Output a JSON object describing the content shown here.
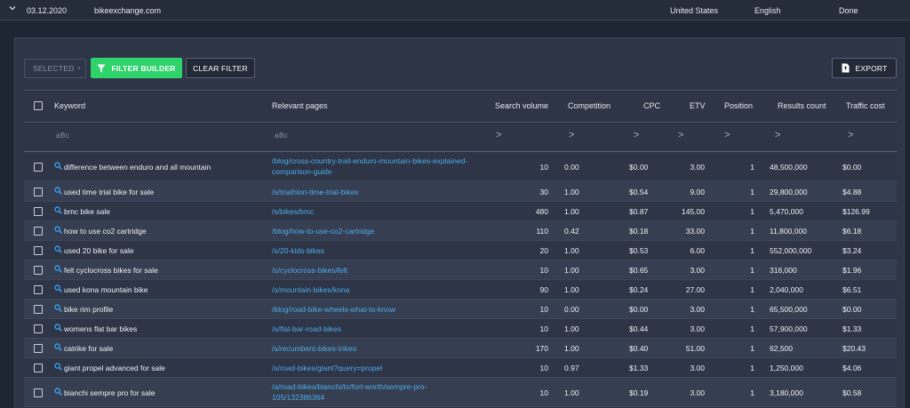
{
  "summary": {
    "date": "03.12.2020",
    "domain": "bikeexchange.com",
    "country": "United States",
    "language": "English",
    "status": "Done"
  },
  "toolbar": {
    "selected_label": "SELECTED",
    "filter_builder_label": "FILTER BUILDER",
    "clear_filter_label": "CLEAR FILTER",
    "export_label": "EXPORT"
  },
  "columns": {
    "keyword": "Keyword",
    "relevant_pages": "Relevant pages",
    "search_volume": "Search volume",
    "competition": "Competition",
    "cpc": "CPC",
    "etv": "ETV",
    "position": "Position",
    "results_count": "Results count",
    "traffic_cost": "Traffic cost"
  },
  "filters": {
    "text_symbol": "aBc",
    "number_symbol": ">"
  },
  "icons": {
    "magnifier": "search-icon",
    "funnel": "filter-icon",
    "export": "export-file-icon",
    "chevron": "chevron-down-icon"
  },
  "colors": {
    "accent_green": "#2fd36c",
    "link_blue": "#4fa9e8",
    "magnifier_blue": "#3b9be8"
  },
  "rows": [
    {
      "keyword": "difference between enduro and all mountain",
      "page": "/blog/cross-country-trail-enduro-mountain-bikes-explained-comparison-guide",
      "volume": "10",
      "competition": "0.00",
      "cpc": "$0.00",
      "etv": "3.00",
      "position": "1",
      "results": "48,500,000",
      "cost": "$0.00"
    },
    {
      "keyword": "used time trial bike for sale",
      "page": "/s/triathlon-time-trial-bikes",
      "volume": "30",
      "competition": "1.00",
      "cpc": "$0.54",
      "etv": "9.00",
      "position": "1",
      "results": "29,800,000",
      "cost": "$4.88"
    },
    {
      "keyword": "bmc bike sale",
      "page": "/s/bikes/bmc",
      "volume": "480",
      "competition": "1.00",
      "cpc": "$0.87",
      "etv": "145.00",
      "position": "1",
      "results": "5,470,000",
      "cost": "$126.99"
    },
    {
      "keyword": "how to use co2 cartridge",
      "page": "/blog/how-to-use-co2-cartridge",
      "volume": "110",
      "competition": "0.42",
      "cpc": "$0.18",
      "etv": "33.00",
      "position": "1",
      "results": "11,800,000",
      "cost": "$6.18"
    },
    {
      "keyword": "used 20 bike for sale",
      "page": "/s/20-kids-bikes",
      "volume": "20",
      "competition": "1.00",
      "cpc": "$0.53",
      "etv": "6.00",
      "position": "1",
      "results": "552,000,000",
      "cost": "$3.24"
    },
    {
      "keyword": "felt cyclocross bikes for sale",
      "page": "/s/cyclocross-bikes/felt",
      "volume": "10",
      "competition": "1.00",
      "cpc": "$0.65",
      "etv": "3.00",
      "position": "1",
      "results": "316,000",
      "cost": "$1.96"
    },
    {
      "keyword": "used kona mountain bike",
      "page": "/s/mountain-bikes/kona",
      "volume": "90",
      "competition": "1.00",
      "cpc": "$0.24",
      "etv": "27.00",
      "position": "1",
      "results": "2,040,000",
      "cost": "$6.51"
    },
    {
      "keyword": "bike rim profile",
      "page": "/blog/road-bike-wheels-what-to-know",
      "volume": "10",
      "competition": "0.00",
      "cpc": "$0.00",
      "etv": "3.00",
      "position": "1",
      "results": "65,500,000",
      "cost": "$0.00"
    },
    {
      "keyword": "womens flat bar bikes",
      "page": "/s/flat-bar-road-bikes",
      "volume": "10",
      "competition": "1.00",
      "cpc": "$0.44",
      "etv": "3.00",
      "position": "1",
      "results": "57,900,000",
      "cost": "$1.33"
    },
    {
      "keyword": "catrike for sale",
      "page": "/s/recumbent-bikes-trikes",
      "volume": "170",
      "competition": "1.00",
      "cpc": "$0.40",
      "etv": "51.00",
      "position": "1",
      "results": "62,500",
      "cost": "$20.43"
    },
    {
      "keyword": "giant propel advanced for sale",
      "page": "/s/road-bikes/giant?query=propel",
      "volume": "10",
      "competition": "0.97",
      "cpc": "$1.33",
      "etv": "3.00",
      "position": "1",
      "results": "1,250,000",
      "cost": "$4.06"
    },
    {
      "keyword": "bianchi sempre pro for sale",
      "page": "/a/road-bikes/bianchi/tx/fort-worth/sempre-pro-105/132386364",
      "volume": "10",
      "competition": "1.00",
      "cpc": "$0.19",
      "etv": "3.00",
      "position": "1",
      "results": "3,180,000",
      "cost": "$0.58"
    }
  ]
}
